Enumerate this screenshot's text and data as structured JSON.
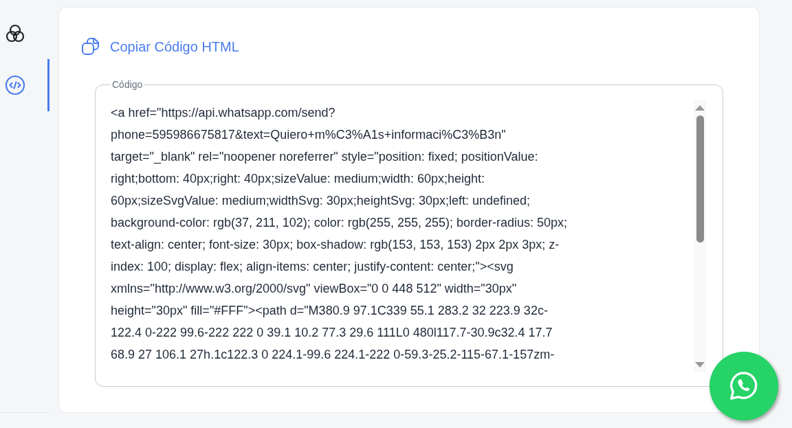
{
  "sidebar": {
    "items": [
      {
        "kind": "circles",
        "selected": false
      },
      {
        "kind": "code",
        "selected": true
      }
    ]
  },
  "card": {
    "title": "Copiar Código HTML",
    "code_field": {
      "label": "Código",
      "value_lines": [
        "<a href=\"https://api.whatsapp.com/send?",
        "phone=595986675817&text=Quiero+m%C3%A1s+informaci%C3%B3n\"",
        "target=\"_blank\" rel=\"noopener noreferrer\" style=\"position: fixed; positionValue:",
        "right;bottom: 40px;right: 40px;sizeValue: medium;width: 60px;height:",
        "60px;sizeSvgValue: medium;widthSvg: 30px;heightSvg: 30px;left: undefined;",
        "background-color: rgb(37, 211, 102); color: rgb(255, 255, 255); border-radius: 50px;",
        "text-align: center; font-size: 30px; box-shadow: rgb(153, 153, 153) 2px 2px 3px; z-",
        "index: 100; display: flex; align-items: center; justify-content: center;\"><svg",
        "xmlns=\"http://www.w3.org/2000/svg\" viewBox=\"0 0 448 512\" width=\"30px\"",
        "height=\"30px\" fill=\"#FFF\"><path d=\"M380.9 97.1C339 55.1 283.2 32 223.9 32c-",
        "122.4 0-222 99.6-222 222 0 39.1 10.2 77.3 29.6 111L0 480l117.7-30.9c32.4 17.7",
        "68.9 27 106.1 27h.1c122.3 0 224.1-99.6 224.1-222 0-59.3-25.2-115-67.1-157zm-"
      ]
    }
  }
}
